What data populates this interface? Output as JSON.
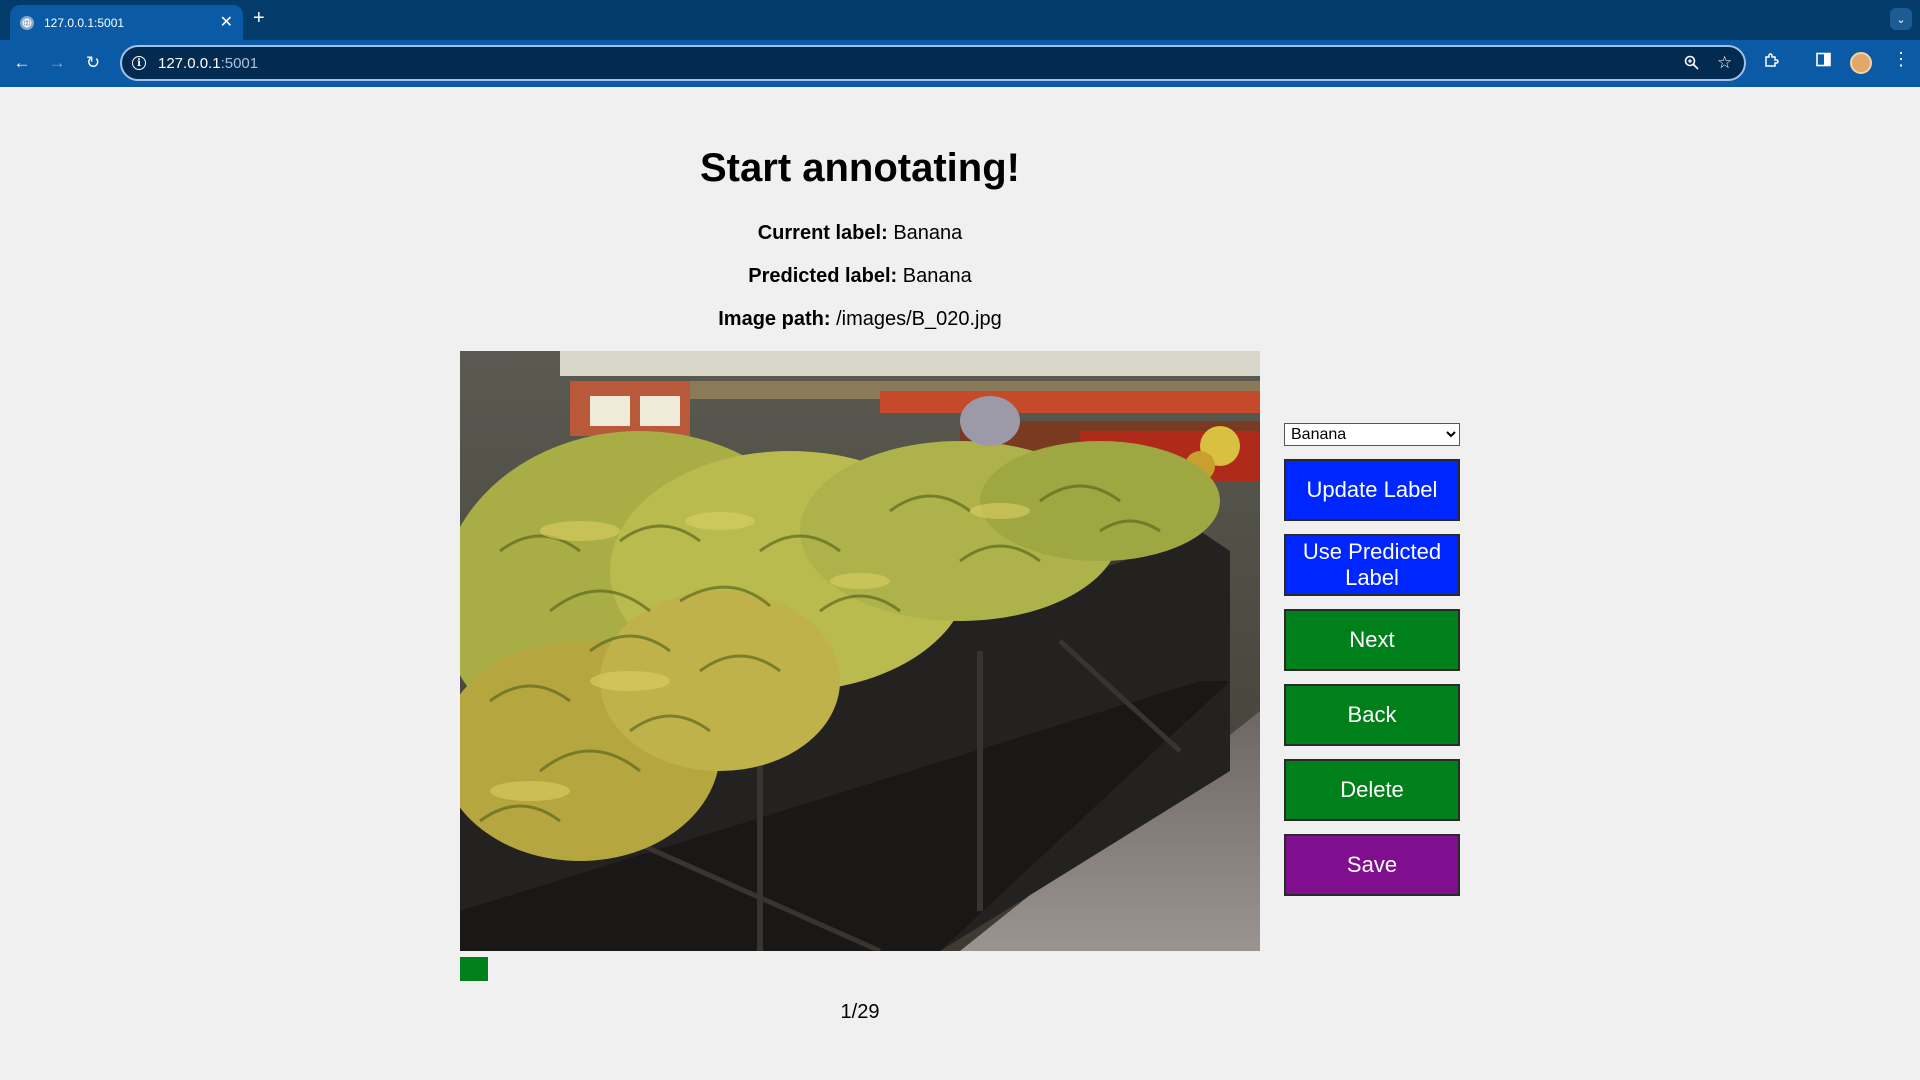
{
  "browser": {
    "tab_title": "127.0.0.1:5001",
    "url_host": "127.0.0.1",
    "url_port": ":5001"
  },
  "page": {
    "heading": "Start annotating!",
    "current_label_key": "Current label:",
    "current_label_value": "Banana",
    "predicted_label_key": "Predicted label:",
    "predicted_label_value": "Banana",
    "image_path_key": "Image path:",
    "image_path_value": "/images/B_020.jpg",
    "counter": "1/29"
  },
  "controls": {
    "select_value": "Banana",
    "select_options": [
      "Banana"
    ],
    "update_label": "Update Label",
    "use_predicted_label": "Use Predicted Label",
    "next": "Next",
    "back": "Back",
    "delete": "Delete",
    "save": "Save"
  },
  "colors": {
    "browser_dark": "#033b6b",
    "browser_toolbar": "#0a5aa6",
    "button_blue": "#0026ff",
    "button_green": "#00801a",
    "button_purple": "#800f8f",
    "page_bg": "#f0f0f0"
  },
  "icons": [
    "globe-icon",
    "close-icon",
    "plus-icon",
    "back-arrow-icon",
    "forward-arrow-icon",
    "reload-icon",
    "info-icon",
    "zoom-icon",
    "star-icon",
    "extensions-icon",
    "side-panel-icon",
    "profile-avatar",
    "menu-dots-icon",
    "tab-search-icon"
  ]
}
